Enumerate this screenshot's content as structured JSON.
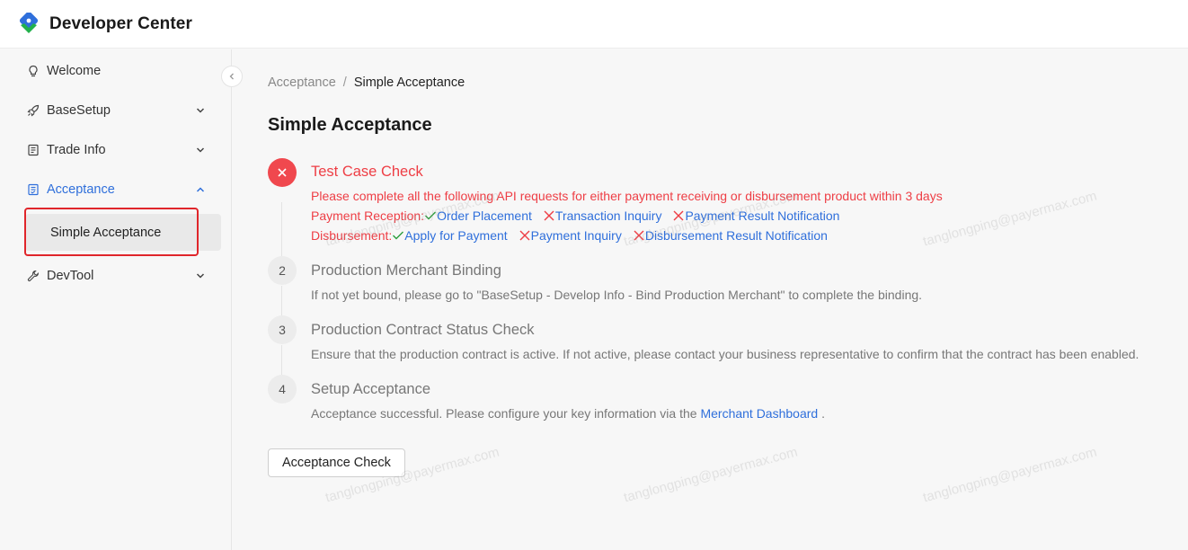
{
  "header": {
    "title": "Developer Center"
  },
  "sidebar": {
    "items": [
      {
        "label": "Welcome",
        "icon": "lightbulb-icon"
      },
      {
        "label": "BaseSetup",
        "icon": "rocket-icon"
      },
      {
        "label": "Trade Info",
        "icon": "document-icon"
      },
      {
        "label": "Acceptance",
        "icon": "checklist-icon"
      },
      {
        "label": "DevTool",
        "icon": "wrench-icon"
      }
    ],
    "sub_item": "Simple Acceptance"
  },
  "breadcrumb": {
    "parent": "Acceptance",
    "separator": "/",
    "current": "Simple Acceptance"
  },
  "page_title": "Simple Acceptance",
  "steps": [
    {
      "number": "1",
      "status": "error",
      "title": "Test Case Check",
      "desc": "Please complete all the following API requests for either payment receiving or disbursement product within 3 days",
      "payment_label": "Payment Reception:",
      "payment_items": [
        {
          "label": "Order Placement",
          "done": true
        },
        {
          "label": "Transaction Inquiry",
          "done": false
        },
        {
          "label": "Payment Result Notification",
          "done": false
        }
      ],
      "disbursement_label": "Disbursement:",
      "disbursement_items": [
        {
          "label": "Apply for Payment",
          "done": true
        },
        {
          "label": "Payment Inquiry",
          "done": false
        },
        {
          "label": "Disbursement Result Notification",
          "done": false
        }
      ]
    },
    {
      "number": "2",
      "title": "Production Merchant Binding",
      "desc": "If not yet bound, please go to \"BaseSetup - Develop Info - Bind Production Merchant\" to complete the binding."
    },
    {
      "number": "3",
      "title": "Production Contract Status Check",
      "desc": "Ensure that the production contract is active. If not active, please contact your business representative to confirm that the contract has been enabled."
    },
    {
      "number": "4",
      "title": "Setup Acceptance",
      "desc_prefix": "Acceptance successful. Please configure your key information via the",
      "desc_link": "Merchant Dashboard",
      "desc_suffix": "."
    }
  ],
  "acceptance_button": "Acceptance Check",
  "watermark": "tanglongping@payermax.com",
  "colors": {
    "accent": "#2f6fdb",
    "error": "#ee3e45",
    "success": "#2a9d3a"
  }
}
